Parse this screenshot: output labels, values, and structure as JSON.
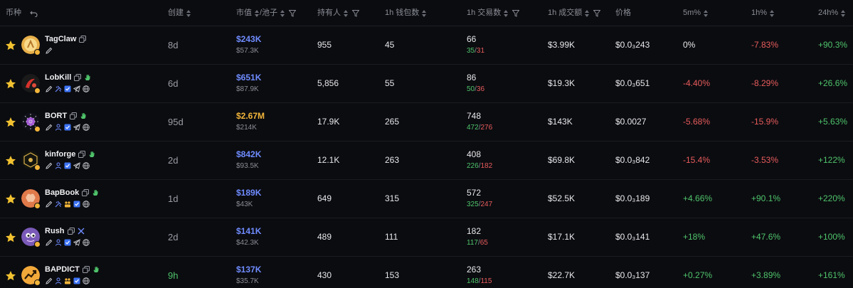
{
  "header": {
    "coin": "币种",
    "created": "创建",
    "mcap": "市值",
    "pool": "/池子",
    "holders": "持有人",
    "wallets_1h": "1h 钱包数",
    "tx_1h": "1h 交易数",
    "vol_1h": "1h 成交额",
    "price": "价格",
    "chg_5m": "5m%",
    "chg_1h": "1h%",
    "chg_24h": "24h%"
  },
  "icons": {
    "reset": "undo-icon",
    "filter": "filter-icon",
    "sort": "sort-icon",
    "favorite": "star-icon",
    "copy": "copy-icon",
    "hand": "hand-icon",
    "edit": "edit-icon",
    "user": "user-icon",
    "verified": "verified-icon",
    "telegram": "telegram-icon",
    "website": "globe-icon"
  },
  "colors": {
    "background": "#0b0c10",
    "accent_blue": "#6f8cff",
    "accent_gold": "#f2b53a",
    "positive": "#4fc46b",
    "negative": "#e85c5c"
  },
  "rows": [
    {
      "name": "TagClaw",
      "created": "8d",
      "mcap": "$243K",
      "pool": "$57.3K",
      "holders": "955",
      "wallets": "45",
      "tx": "66",
      "buys": "35",
      "sells": "31",
      "vol": "$3.99K",
      "price": "$0.0₃243",
      "chg_5m": "0%",
      "chg_1h": "-7.83%",
      "chg_24h": "+90.3%"
    },
    {
      "name": "LobKill",
      "created": "6d",
      "mcap": "$651K",
      "pool": "$87.9K",
      "holders": "5,856",
      "wallets": "55",
      "tx": "86",
      "buys": "50",
      "sells": "36",
      "vol": "$19.3K",
      "price": "$0.0₃651",
      "chg_5m": "-4.40%",
      "chg_1h": "-8.29%",
      "chg_24h": "+26.6%"
    },
    {
      "name": "BORT",
      "created": "95d",
      "mcap": "$2.67M",
      "pool": "$214K",
      "holders": "17.9K",
      "wallets": "265",
      "tx": "748",
      "buys": "472",
      "sells": "276",
      "vol": "$143K",
      "price": "$0.0027",
      "chg_5m": "-5.68%",
      "chg_1h": "-15.9%",
      "chg_24h": "+5.63%"
    },
    {
      "name": "kinforge",
      "created": "2d",
      "mcap": "$842K",
      "pool": "$93.5K",
      "holders": "12.1K",
      "wallets": "263",
      "tx": "408",
      "buys": "226",
      "sells": "182",
      "vol": "$69.8K",
      "price": "$0.0₃842",
      "chg_5m": "-15.4%",
      "chg_1h": "-3.53%",
      "chg_24h": "+122%"
    },
    {
      "name": "BapBook",
      "created": "1d",
      "mcap": "$189K",
      "pool": "$43K",
      "holders": "649",
      "wallets": "315",
      "tx": "572",
      "buys": "325",
      "sells": "247",
      "vol": "$52.5K",
      "price": "$0.0₃189",
      "chg_5m": "+4.66%",
      "chg_1h": "+90.1%",
      "chg_24h": "+220%"
    },
    {
      "name": "Rush",
      "created": "2d",
      "mcap": "$141K",
      "pool": "$42.3K",
      "holders": "489",
      "wallets": "111",
      "tx": "182",
      "buys": "117",
      "sells": "65",
      "vol": "$17.1K",
      "price": "$0.0₃141",
      "chg_5m": "+18%",
      "chg_1h": "+47.6%",
      "chg_24h": "+100%"
    },
    {
      "name": "BAPDICT",
      "created": "9h",
      "mcap": "$137K",
      "pool": "$35.7K",
      "holders": "430",
      "wallets": "153",
      "tx": "263",
      "buys": "148",
      "sells": "115",
      "vol": "$22.7K",
      "price": "$0.0₃137",
      "chg_5m": "+0.27%",
      "chg_1h": "+3.89%",
      "chg_24h": "+161%"
    }
  ]
}
